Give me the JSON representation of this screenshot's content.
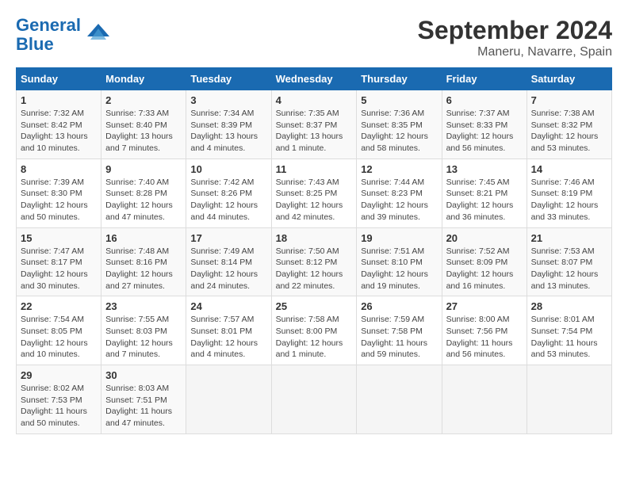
{
  "header": {
    "logo_line1": "General",
    "logo_line2": "Blue",
    "title": "September 2024",
    "subtitle": "Maneru, Navarre, Spain"
  },
  "calendar": {
    "days_of_week": [
      "Sunday",
      "Monday",
      "Tuesday",
      "Wednesday",
      "Thursday",
      "Friday",
      "Saturday"
    ],
    "weeks": [
      [
        null,
        {
          "day": 2,
          "sunrise": "7:33 AM",
          "sunset": "8:40 PM",
          "daylight": "13 hours and 7 minutes."
        },
        {
          "day": 3,
          "sunrise": "7:34 AM",
          "sunset": "8:39 PM",
          "daylight": "13 hours and 4 minutes."
        },
        {
          "day": 4,
          "sunrise": "7:35 AM",
          "sunset": "8:37 PM",
          "daylight": "13 hours and 1 minute."
        },
        {
          "day": 5,
          "sunrise": "7:36 AM",
          "sunset": "8:35 PM",
          "daylight": "12 hours and 58 minutes."
        },
        {
          "day": 6,
          "sunrise": "7:37 AM",
          "sunset": "8:33 PM",
          "daylight": "12 hours and 56 minutes."
        },
        {
          "day": 7,
          "sunrise": "7:38 AM",
          "sunset": "8:32 PM",
          "daylight": "12 hours and 53 minutes."
        }
      ],
      [
        {
          "day": 8,
          "sunrise": "7:39 AM",
          "sunset": "8:30 PM",
          "daylight": "12 hours and 50 minutes."
        },
        {
          "day": 9,
          "sunrise": "7:40 AM",
          "sunset": "8:28 PM",
          "daylight": "12 hours and 47 minutes."
        },
        {
          "day": 10,
          "sunrise": "7:42 AM",
          "sunset": "8:26 PM",
          "daylight": "12 hours and 44 minutes."
        },
        {
          "day": 11,
          "sunrise": "7:43 AM",
          "sunset": "8:25 PM",
          "daylight": "12 hours and 42 minutes."
        },
        {
          "day": 12,
          "sunrise": "7:44 AM",
          "sunset": "8:23 PM",
          "daylight": "12 hours and 39 minutes."
        },
        {
          "day": 13,
          "sunrise": "7:45 AM",
          "sunset": "8:21 PM",
          "daylight": "12 hours and 36 minutes."
        },
        {
          "day": 14,
          "sunrise": "7:46 AM",
          "sunset": "8:19 PM",
          "daylight": "12 hours and 33 minutes."
        }
      ],
      [
        {
          "day": 15,
          "sunrise": "7:47 AM",
          "sunset": "8:17 PM",
          "daylight": "12 hours and 30 minutes."
        },
        {
          "day": 16,
          "sunrise": "7:48 AM",
          "sunset": "8:16 PM",
          "daylight": "12 hours and 27 minutes."
        },
        {
          "day": 17,
          "sunrise": "7:49 AM",
          "sunset": "8:14 PM",
          "daylight": "12 hours and 24 minutes."
        },
        {
          "day": 18,
          "sunrise": "7:50 AM",
          "sunset": "8:12 PM",
          "daylight": "12 hours and 22 minutes."
        },
        {
          "day": 19,
          "sunrise": "7:51 AM",
          "sunset": "8:10 PM",
          "daylight": "12 hours and 19 minutes."
        },
        {
          "day": 20,
          "sunrise": "7:52 AM",
          "sunset": "8:09 PM",
          "daylight": "12 hours and 16 minutes."
        },
        {
          "day": 21,
          "sunrise": "7:53 AM",
          "sunset": "8:07 PM",
          "daylight": "12 hours and 13 minutes."
        }
      ],
      [
        {
          "day": 22,
          "sunrise": "7:54 AM",
          "sunset": "8:05 PM",
          "daylight": "12 hours and 10 minutes."
        },
        {
          "day": 23,
          "sunrise": "7:55 AM",
          "sunset": "8:03 PM",
          "daylight": "12 hours and 7 minutes."
        },
        {
          "day": 24,
          "sunrise": "7:57 AM",
          "sunset": "8:01 PM",
          "daylight": "12 hours and 4 minutes."
        },
        {
          "day": 25,
          "sunrise": "7:58 AM",
          "sunset": "8:00 PM",
          "daylight": "12 hours and 1 minute."
        },
        {
          "day": 26,
          "sunrise": "7:59 AM",
          "sunset": "7:58 PM",
          "daylight": "11 hours and 59 minutes."
        },
        {
          "day": 27,
          "sunrise": "8:00 AM",
          "sunset": "7:56 PM",
          "daylight": "11 hours and 56 minutes."
        },
        {
          "day": 28,
          "sunrise": "8:01 AM",
          "sunset": "7:54 PM",
          "daylight": "11 hours and 53 minutes."
        }
      ],
      [
        {
          "day": 29,
          "sunrise": "8:02 AM",
          "sunset": "7:53 PM",
          "daylight": "11 hours and 50 minutes."
        },
        {
          "day": 30,
          "sunrise": "8:03 AM",
          "sunset": "7:51 PM",
          "daylight": "11 hours and 47 minutes."
        },
        null,
        null,
        null,
        null,
        null
      ]
    ]
  },
  "day1": {
    "day": 1,
    "sunrise": "7:32 AM",
    "sunset": "8:42 PM",
    "daylight": "13 hours and 10 minutes."
  }
}
